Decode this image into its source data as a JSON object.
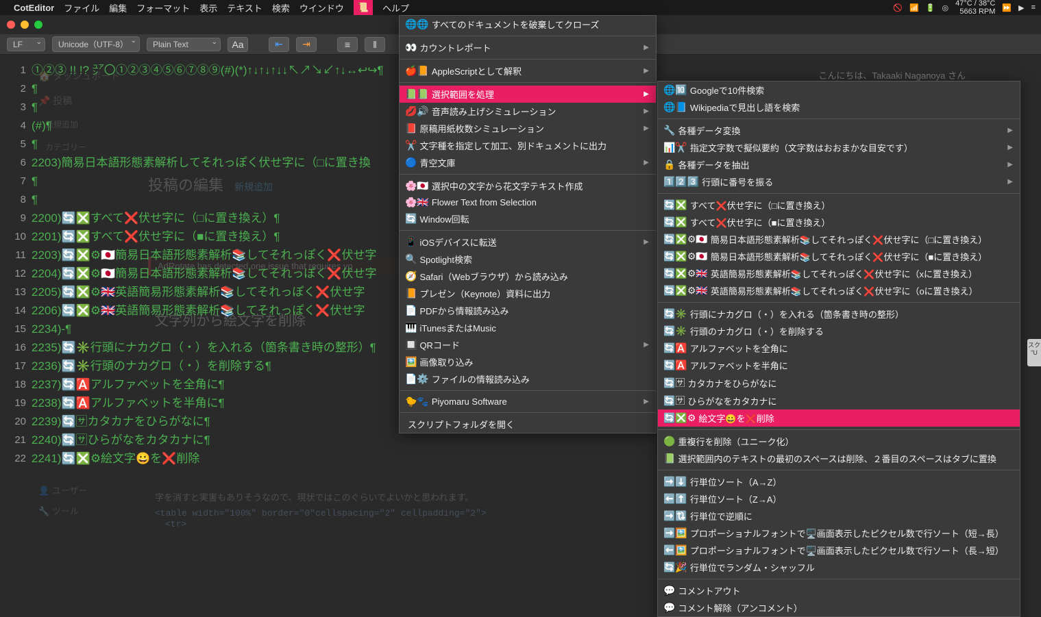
{
  "menubar": {
    "app": "CotEditor",
    "items": [
      "ファイル",
      "編集",
      "フォーマット",
      "表示",
      "テキスト",
      "検索",
      "ウインドウ"
    ],
    "help": "ヘルプ",
    "temp_line1": "47°C / 38°C",
    "temp_line2": "5663 RPM"
  },
  "toolbar": {
    "line_ending": "LF",
    "encoding": "Unicode（UTF-8）",
    "syntax": "Plain Text"
  },
  "greeting": "こんにちは、Takaaki Naganoya さん",
  "ghost": {
    "dashboard": "ダッシュボード",
    "post": "投稿",
    "add_new": "新規追加",
    "category": "カテゴリー",
    "edit_title": "投稿の編集",
    "edit_add": "新規追加",
    "warning": "AdRotate has detected one issue that requires yo",
    "section": "文字列から絵文字を削除",
    "footer1": "字を消すと実害もありそうなので、現状ではこのぐらいでよいかと思われます。",
    "footer2": "<table width=\"100%\" border=\"0\"cellspacing=\"2\" cellpadding=\"2\">",
    "footer3": "<tr>",
    "user": "ユーザー",
    "tool": "ツール"
  },
  "lines": [
    {
      "n": "1",
      "t": "①②③ !! !? ㍐〇①②③④⑤⑥⑦⑧⑨(#)(*)↑↓↑↓↑↓↓↖↗↘↙↑↓↔↩↪¶"
    },
    {
      "n": "2",
      "t": "¶"
    },
    {
      "n": "3",
      "t": "¶"
    },
    {
      "n": "4",
      "t": "(#)¶"
    },
    {
      "n": "5",
      "t": "¶"
    },
    {
      "n": "6",
      "t": "2203)簡易日本語形態素解析してそれっぽく伏せ字に（□に置き換"
    },
    {
      "n": "7",
      "t": "¶"
    },
    {
      "n": "8",
      "t": "¶"
    },
    {
      "n": "9",
      "t": "2200)🔄❎すべて❌伏せ字に（□に置き換え）¶"
    },
    {
      "n": "10",
      "t": "2201)🔄❎すべて❌伏せ字に（■に置き換え）¶"
    },
    {
      "n": "11",
      "t": "2203)🔄❎⚙🇯🇵簡易日本語形態素解析📚してそれっぽく❌伏せ字"
    },
    {
      "n": "12",
      "t": "2204)🔄❎⚙🇯🇵簡易日本語形態素解析📚してそれっぽく❌伏せ字"
    },
    {
      "n": "13",
      "t": "2205)🔄❎⚙🇬🇧英語簡易形態素解析📚してそれっぽく❌伏せ字"
    },
    {
      "n": "14",
      "t": "2206)🔄❎⚙🇬🇧英語簡易形態素解析📚してそれっぽく❌伏せ字"
    },
    {
      "n": "15",
      "t": "2234)-¶"
    },
    {
      "n": "16",
      "t": "2235)🔄✳️行頭にナカグロ（・）を入れる（箇条書き時の整形）¶"
    },
    {
      "n": "17",
      "t": "2236)🔄✳️行頭のナカグロ（・）を削除する¶"
    },
    {
      "n": "18",
      "t": "2237)🔄🅰️アルファベットを全角に¶"
    },
    {
      "n": "19",
      "t": "2238)🔄🅰️アルファベットを半角に¶"
    },
    {
      "n": "20",
      "t": "2239)🔄🈂カタカナをひらがなに¶"
    },
    {
      "n": "21",
      "t": "2240)🔄🈂ひらがなをカタカナに¶"
    },
    {
      "n": "22",
      "t": "2241)🔄❎⚙絵文字😀を❌削除"
    }
  ],
  "menu1": [
    {
      "icons": "🌐🌐",
      "label": "すべてのドキュメントを破棄してクローズ",
      "sep_after": true
    },
    {
      "icons": "👀",
      "label": "カウントレポート",
      "arrow": true,
      "sep_after": true
    },
    {
      "icons": "🍎📙",
      "label": "AppleScriptとして解釈",
      "arrow": true,
      "sep_after": true
    },
    {
      "icons": "📗📗",
      "label": "選択範囲を処理",
      "arrow": true,
      "sel": true
    },
    {
      "icons": "💋🔊",
      "label": "音声読み上げシミュレーション",
      "arrow": true
    },
    {
      "icons": "📕",
      "label": "原稿用紙枚数シミュレーション",
      "arrow": true
    },
    {
      "icons": "✂️",
      "label": "文字種を指定して加工、別ドキュメントに出力"
    },
    {
      "icons": "🔵",
      "label": "青空文庫",
      "arrow": true,
      "sep_after": true
    },
    {
      "icons": "🌸🇯🇵",
      "label": "選択中の文字から花文字テキスト作成"
    },
    {
      "icons": "🌸🇬🇧",
      "label": "Flower Text from Selection"
    },
    {
      "icons": "🔄",
      "label": "Window回転",
      "sep_after": true
    },
    {
      "icons": "📱",
      "label": "iOSデバイスに転送",
      "arrow": true
    },
    {
      "icons": "🔍",
      "label": "Spotlight検索"
    },
    {
      "icons": "🧭",
      "label": "Safari（Webブラウザ）から読み込み"
    },
    {
      "icons": "📙",
      "label": "プレゼン（Keynote）資料に出力"
    },
    {
      "icons": "📄",
      "label": "PDFから情報読み込み"
    },
    {
      "icons": "🎹",
      "label": "iTunesまたはMusic"
    },
    {
      "icons": "🔲",
      "label": "QRコード",
      "arrow": true
    },
    {
      "icons": "🖼️",
      "label": "画像取り込み"
    },
    {
      "icons": "📄⚙️",
      "label": "ファイルの情報読み込み",
      "sep_after": true
    },
    {
      "icons": "🐤🐾",
      "label": "Piyomaru Software",
      "arrow": true,
      "sep_after": true
    },
    {
      "icons": "",
      "label": "スクリプトフォルダを開く"
    }
  ],
  "menu2": [
    {
      "icons": "🌐🔟",
      "label": "Googleで10件検索"
    },
    {
      "icons": "🌐📘",
      "label": "Wikipediaで見出し語を検索",
      "sep_after": true
    },
    {
      "icons": "🔧",
      "label": "各種データ変換",
      "arrow": true
    },
    {
      "icons": "📊✂️",
      "label": "指定文字数で擬似要約（文字数はおおまかな目安です）",
      "arrow": true
    },
    {
      "icons": "🔒",
      "label": "各種データを抽出",
      "arrow": true
    },
    {
      "icons": "1️⃣2️⃣3️⃣",
      "label": "行頭に番号を振る",
      "arrow": true,
      "sep_after": true
    },
    {
      "icons": "🔄❎",
      "label": "すべて❌伏せ字に（□に置き換え）"
    },
    {
      "icons": "🔄❎",
      "label": "すべて❌伏せ字に（■に置き換え）"
    },
    {
      "icons": "🔄❎⚙🇯🇵",
      "label": "簡易日本語形態素解析📚してそれっぽく❌伏せ字に（□に置き換え）"
    },
    {
      "icons": "🔄❎⚙🇯🇵",
      "label": "簡易日本語形態素解析📚してそれっぽく❌伏せ字に（■に置き換え）"
    },
    {
      "icons": "🔄❎⚙🇬🇧",
      "label": "英語簡易形態素解析📚してそれっぽく❌伏せ字に（xに置き換え）"
    },
    {
      "icons": "🔄❎⚙🇬🇧",
      "label": "英語簡易形態素解析📚してそれっぽく❌伏せ字に（oに置き換え）",
      "sep_after": true
    },
    {
      "icons": "🔄✳️",
      "label": "行頭にナカグロ（・）を入れる（箇条書き時の整形）"
    },
    {
      "icons": "🔄✳️",
      "label": "行頭のナカグロ（・）を削除する"
    },
    {
      "icons": "🔄🅰️",
      "label": "アルファベットを全角に"
    },
    {
      "icons": "🔄🅰️",
      "label": "アルファベットを半角に"
    },
    {
      "icons": "🔄🈂",
      "label": "カタカナをひらがなに"
    },
    {
      "icons": "🔄🈂",
      "label": "ひらがなをカタカナに"
    },
    {
      "icons": "🔄❎⚙",
      "label": "絵文字😀を❌削除",
      "sel": true,
      "sep_after": true
    },
    {
      "icons": "🟢",
      "label": "重複行を削除（ユニーク化）"
    },
    {
      "icons": "📗",
      "label": "選択範囲内のテキストの最初のスペースは削除、２番目のスペースはタブに置換",
      "sep_after": true
    },
    {
      "icons": "➡️⬇️",
      "label": "行単位ソート（A→Z）"
    },
    {
      "icons": "⬅️⬆️",
      "label": "行単位ソート（Z→A）"
    },
    {
      "icons": "➡️🔃",
      "label": "行単位で逆順に"
    },
    {
      "icons": "➡️🖼️",
      "label": "プロポーショナルフォントで🖥️画面表示したピクセル数で行ソート（短→長）"
    },
    {
      "icons": "⬅️🖼️",
      "label": "プロポーショナルフォントで🖥️画面表示したピクセル数で行ソート（長→短）"
    },
    {
      "icons": "🔄🎉",
      "label": "行単位でランダム・シャッフル",
      "sep_after": true
    },
    {
      "icons": "💬",
      "label": "コメントアウト"
    },
    {
      "icons": "💬",
      "label": "コメント解除（アンコメント）"
    }
  ],
  "right_badge": "スク\n\"U"
}
